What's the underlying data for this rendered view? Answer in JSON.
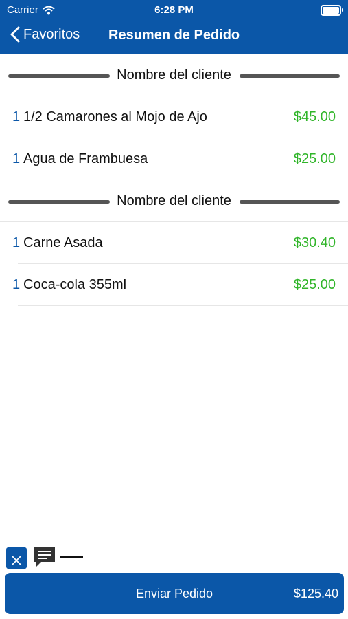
{
  "status": {
    "carrier": "Carrier",
    "time": "6:28 PM"
  },
  "nav": {
    "back_label": "Favoritos",
    "title": "Resumen de Pedido"
  },
  "groups": [
    {
      "header": "Nombre del cliente",
      "items": [
        {
          "qty": "1",
          "name": "1/2 Camarones al Mojo de Ajo",
          "price": "$45.00"
        },
        {
          "qty": "1",
          "name": "Agua de Frambuesa",
          "price": "$25.00"
        }
      ]
    },
    {
      "header": "Nombre del cliente",
      "items": [
        {
          "qty": "1",
          "name": "Carne Asada",
          "price": "$30.40"
        },
        {
          "qty": "1",
          "name": "Coca-cola 355ml",
          "price": "$25.00"
        }
      ]
    }
  ],
  "toolbar": {
    "icons": [
      "food-icon",
      "note-icon",
      "dash-icon"
    ]
  },
  "submit": {
    "label": "Enviar Pedido",
    "total": "$125.40"
  },
  "colors": {
    "brand": "#0b57a8",
    "price": "#31b52a",
    "separator": "#555555"
  }
}
